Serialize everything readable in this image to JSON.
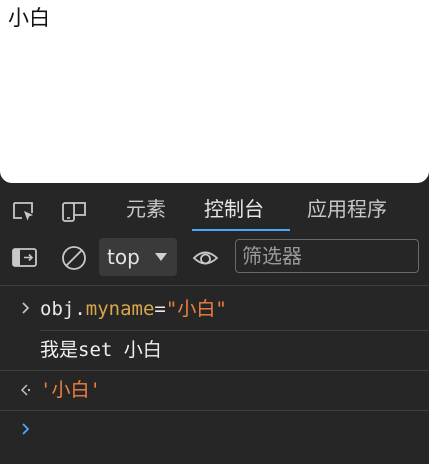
{
  "page": {
    "text": "小白"
  },
  "devtools": {
    "tabs": [
      {
        "label": "元素"
      },
      {
        "label": "控制台"
      },
      {
        "label": "应用程序"
      }
    ],
    "active_tab": "控制台",
    "toolbar": {
      "context": "top",
      "filter_placeholder": "筛选器"
    },
    "console": {
      "input": {
        "obj": "obj",
        "dot": ".",
        "prop": "myname",
        "eq": "=",
        "value": "\"小白\""
      },
      "log_output": "我是set 小白",
      "result": "'小白'"
    },
    "colors": {
      "accent": "#4da6ff",
      "string": "#f08040",
      "property": "#d9a64a",
      "background": "#262626"
    }
  }
}
